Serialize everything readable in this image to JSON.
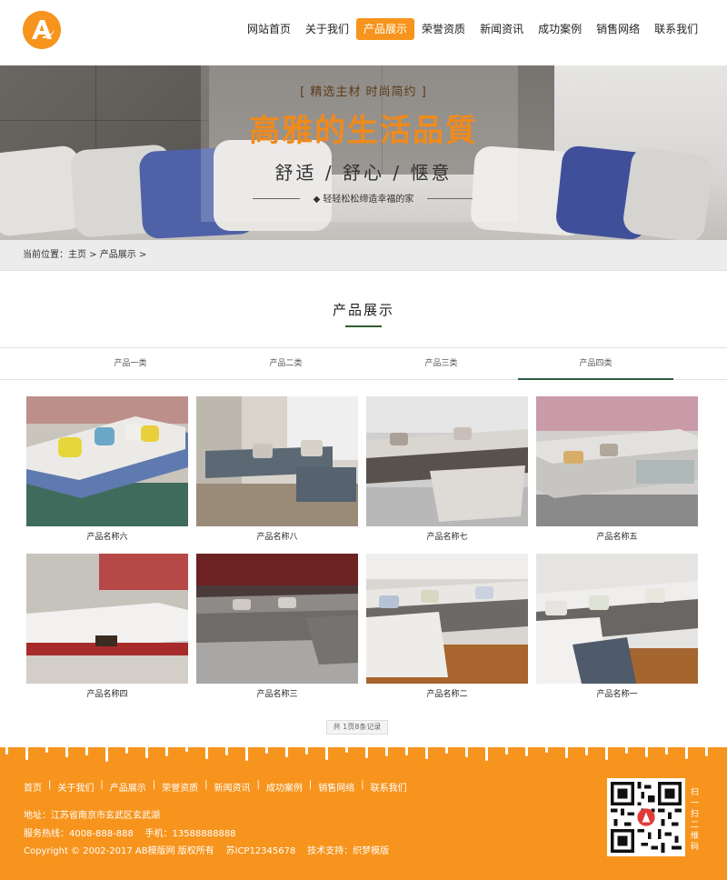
{
  "header": {
    "logo_letter": "A",
    "nav": [
      {
        "label": "网站首页",
        "active": false
      },
      {
        "label": "关于我们",
        "active": false
      },
      {
        "label": "产品展示",
        "active": true
      },
      {
        "label": "荣誉资质",
        "active": false
      },
      {
        "label": "新闻资讯",
        "active": false
      },
      {
        "label": "成功案例",
        "active": false
      },
      {
        "label": "销售网络",
        "active": false
      },
      {
        "label": "联系我们",
        "active": false
      }
    ]
  },
  "banner": {
    "tagline": "[ 精选主材  时尚简约 ]",
    "headline": "高雅的生活品質",
    "subheadline": "舒适 / 舒心 / 惬意",
    "caption": "◆ 轻轻松松缔造幸福的家"
  },
  "breadcrumb": {
    "prefix": "当前位置：",
    "home": "主页",
    "sep": " > ",
    "current": "产品展示",
    "trail": " >"
  },
  "section": {
    "title": "产品展示"
  },
  "tabs": [
    {
      "label": "产品一类",
      "active": false
    },
    {
      "label": "产品二类",
      "active": false
    },
    {
      "label": "产品三类",
      "active": false
    },
    {
      "label": "产品四类",
      "active": true
    }
  ],
  "products": [
    {
      "name": "产品名称六"
    },
    {
      "name": "产品名称八"
    },
    {
      "name": "产品名称七"
    },
    {
      "name": "产品名称五"
    },
    {
      "name": "产品名称四"
    },
    {
      "name": "产品名称三"
    },
    {
      "name": "产品名称二"
    },
    {
      "name": "产品名称一"
    }
  ],
  "pagination": {
    "text": "共 1页8条记录"
  },
  "footer": {
    "nav": [
      "首页",
      "关于我们",
      "产品展示",
      "荣誉资质",
      "新闻资讯",
      "成功案例",
      "销售网络",
      "联系我们"
    ],
    "separator": "|",
    "address": "地址：江苏省南京市玄武区玄武湖",
    "hotline": "服务热线：4008-888-888    手机：13588888888",
    "copyright": "Copyright © 2002-2017 AB模版网 版权所有    苏ICP12345678    技术支持：织梦模版",
    "qr_label": "扫一扫二维码"
  },
  "colors": {
    "accent": "#f7941d",
    "tab_active": "#2d5b3f",
    "section_underline": "#2e5f2b"
  }
}
